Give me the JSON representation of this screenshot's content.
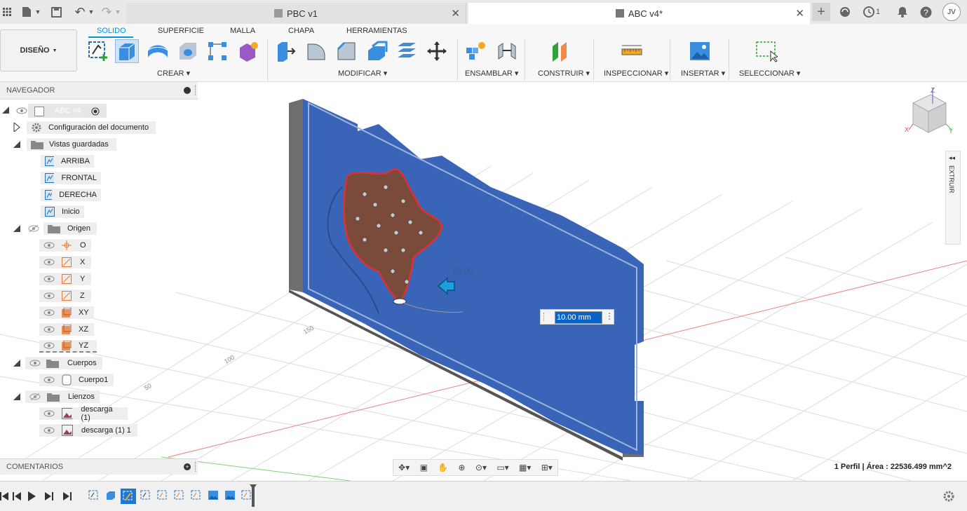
{
  "titlebar": {
    "tabs": [
      {
        "label": "PBC v1",
        "active": false
      },
      {
        "label": "ABC v4*",
        "active": true
      }
    ],
    "job_count": "1",
    "user_initials": "JV"
  },
  "ribbon": {
    "design_button": "DISEÑO",
    "tabs": [
      "SOLIDO",
      "SUPERFICIE",
      "MALLA",
      "CHAPA",
      "HERRAMIENTAS"
    ],
    "active_tab": "SOLIDO",
    "groups": {
      "crear": "CREAR",
      "modificar": "MODIFICAR",
      "ensamblar": "ENSAMBLAR",
      "construir": "CONSTRUIR",
      "inspeccionar": "INSPECCIONAR",
      "insertar": "INSERTAR",
      "seleccionar": "SELECCIONAR"
    },
    "accent_color": "#0696d7"
  },
  "navigator": {
    "title": "NAVEGADOR",
    "root": "ABC v4",
    "items": {
      "doc_settings": "Configuración del documento",
      "saved_views": "Vistas guardadas",
      "view_top": "ARRIBA",
      "view_front": "FRONTAL",
      "view_right": "DERECHA",
      "view_home": "Inicio",
      "origin": "Origen",
      "origin_o": "O",
      "origin_x": "X",
      "origin_y": "Y",
      "origin_z": "Z",
      "origin_xy": "XY",
      "origin_xz": "XZ",
      "origin_yz": "YZ",
      "bodies": "Cuerpos",
      "body1": "Cuerpo1",
      "canvases": "Lienzos",
      "canvas1": "descarga (1)",
      "canvas2": "descarga (1) 1"
    }
  },
  "comments": {
    "title": "COMENTARIOS"
  },
  "viewport": {
    "dimension_label": "10.00",
    "input_value": "10.00 mm",
    "grid_labels": [
      "150",
      "100",
      "50"
    ],
    "extrude_panel_label": "EXTRUIR",
    "status": "1 Perfil | Área : 22536.499 mm^2",
    "viewcube_axes": {
      "z": "Z",
      "x": "X",
      "y": "Y"
    }
  },
  "colors": {
    "body_blue": "#3a64b8",
    "profile_red": "#e03030",
    "grid": "#d8d8d8"
  }
}
